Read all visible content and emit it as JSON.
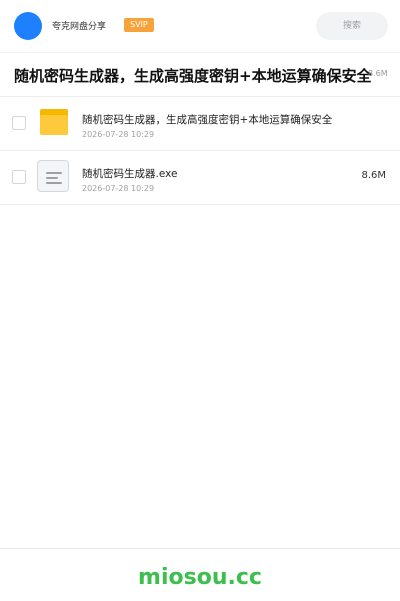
{
  "header": {
    "site_name": "夸克网盘分享",
    "vip_badge": "SVIP",
    "search_label": "搜索"
  },
  "share": {
    "title": "随机密码生成器，生成高强度密钥+本地运算确保安全",
    "size": "8.6M"
  },
  "files": [
    {
      "name": "随机密码生成器，生成高强度密钥+本地运算确保安全",
      "time": "2026-07-28 10:29",
      "size": "",
      "icon": "folder-icon"
    },
    {
      "name": "随机密码生成器.exe",
      "time": "2026-07-28 10:29",
      "size": "8.6M",
      "icon": "file-icon"
    }
  ],
  "footer": {
    "brand": "miosou.cc"
  },
  "colors": {
    "accent": "#1e80ff",
    "vip": "#f7a23b",
    "folder": "#ffc93c",
    "brand": "#3cbf4c"
  }
}
